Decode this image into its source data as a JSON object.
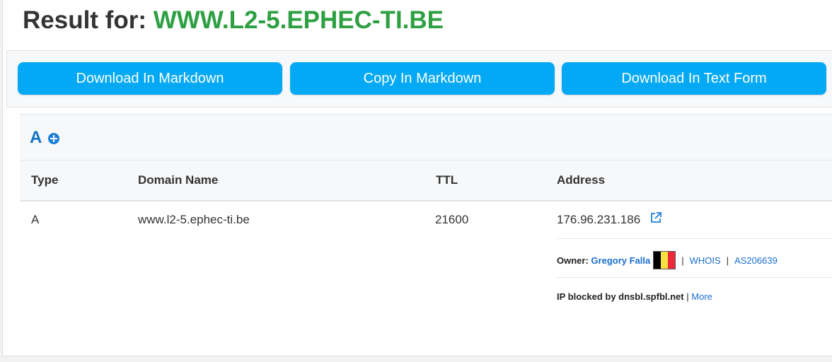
{
  "header": {
    "prefix": "Result for:",
    "domain": "WWW.L2-5.EPHEC-TI.BE"
  },
  "buttons": {
    "download_markdown": "Download In Markdown",
    "copy_markdown": "Copy In Markdown",
    "download_text": "Download In Text Form"
  },
  "section": {
    "title": "A",
    "expand_icon": "plus-circle-icon"
  },
  "table": {
    "columns": [
      "Type",
      "Domain Name",
      "TTL",
      "Address"
    ],
    "rows": [
      {
        "type": "A",
        "domain_name": "www.l2-5.ephec-ti.be",
        "ttl": "21600",
        "address": "176.96.231.186",
        "address_icon": "external-link-icon"
      }
    ]
  },
  "owner": {
    "label": "Owner:",
    "name": "Gregory Falla",
    "flag": {
      "country": "Belgium",
      "colors": [
        "#000000",
        "#FAE042",
        "#ED2939"
      ]
    },
    "separator": "|",
    "whois": "WHOIS",
    "asn": "AS206639"
  },
  "blocklist": {
    "text": "IP blocked by dnsbl.spfbl.net",
    "separator": "|",
    "more": "More"
  },
  "colors": {
    "accent_button": "#03a9f4",
    "domain_green": "#2ea043",
    "link_blue": "#1a6fd1",
    "section_title": "#1172c4"
  }
}
